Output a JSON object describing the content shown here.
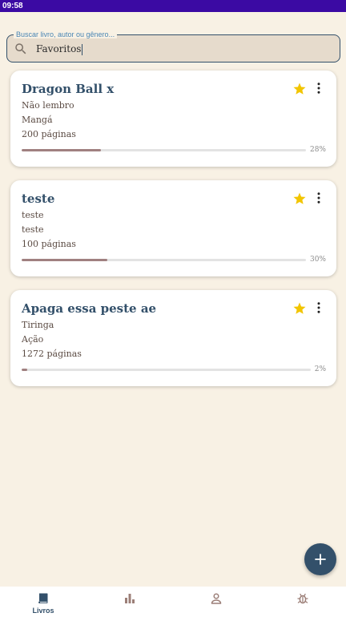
{
  "status_bar": {
    "time": "09:58"
  },
  "search": {
    "label": "Buscar livro, autor ou gênero...",
    "value": "Favoritos"
  },
  "books": [
    {
      "title": "Dragon Ball x",
      "author": "Não lembro",
      "genre": "Mangá",
      "pages": "200 páginas",
      "progress": 0.28,
      "progress_label": "28%",
      "favorite": true
    },
    {
      "title": "teste",
      "author": "teste",
      "genre": "teste",
      "pages": "100 páginas",
      "progress": 0.3,
      "progress_label": "30%",
      "favorite": true
    },
    {
      "title": "Apaga essa peste ae",
      "author": "Tiringa",
      "genre": "Ação",
      "pages": "1272 páginas",
      "progress": 0.02,
      "progress_label": "2%",
      "favorite": true
    }
  ],
  "fab": {
    "icon": "plus-icon"
  },
  "bottom_nav": {
    "items": [
      {
        "icon": "book-icon",
        "label": "Livros",
        "active": true
      },
      {
        "icon": "bar-chart-icon",
        "label": "",
        "active": false
      },
      {
        "icon": "person-icon",
        "label": "",
        "active": false
      },
      {
        "icon": "bug-icon",
        "label": "",
        "active": false
      }
    ]
  },
  "colors": {
    "background": "#f8f1e4",
    "status_bar": "#3b0aa3",
    "primary": "#33506a",
    "favorite_star": "#f2c500",
    "progress_fill": "#a08080",
    "nav_inactive": "#9c7f78"
  }
}
